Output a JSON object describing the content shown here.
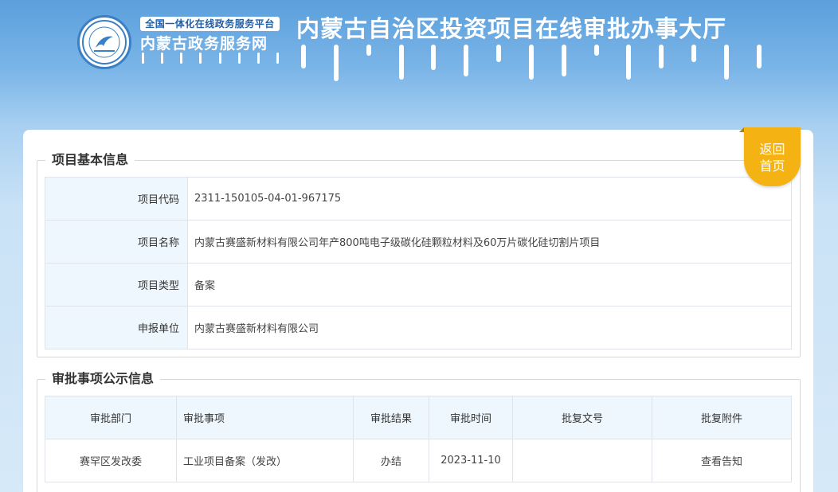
{
  "header": {
    "platform_badge": "全国一体化在线政务服务平台",
    "site_name": "内蒙古政务服务网",
    "main_title": "内蒙古自治区投资项目在线审批办事大厅"
  },
  "back_button": {
    "line1": "返回",
    "line2": "首页"
  },
  "basic_info": {
    "legend": "项目基本信息",
    "rows": [
      {
        "label": "项目代码",
        "value": "2311-150105-04-01-967175"
      },
      {
        "label": "项目名称",
        "value": "内蒙古赛盛新材料有限公司年产800吨电子级碳化硅颗粒材料及60万片碳化硅切割片项目"
      },
      {
        "label": "项目类型",
        "value": "备案"
      },
      {
        "label": "申报单位",
        "value": "内蒙古赛盛新材料有限公司"
      }
    ]
  },
  "approval_info": {
    "legend": "审批事项公示信息",
    "columns": [
      "审批部门",
      "审批事项",
      "审批结果",
      "审批时间",
      "批复文号",
      "批复附件"
    ],
    "rows": [
      {
        "dept": "赛罕区发改委",
        "item": "工业项目备案（发改）",
        "result": "办结",
        "time": "2023-11-10",
        "doc_no": "",
        "attachment": "查看告知"
      }
    ]
  },
  "colors": {
    "accent": "#f4b313",
    "header_blue": "#5b9fdc",
    "label_bg": "#eef7fd"
  }
}
